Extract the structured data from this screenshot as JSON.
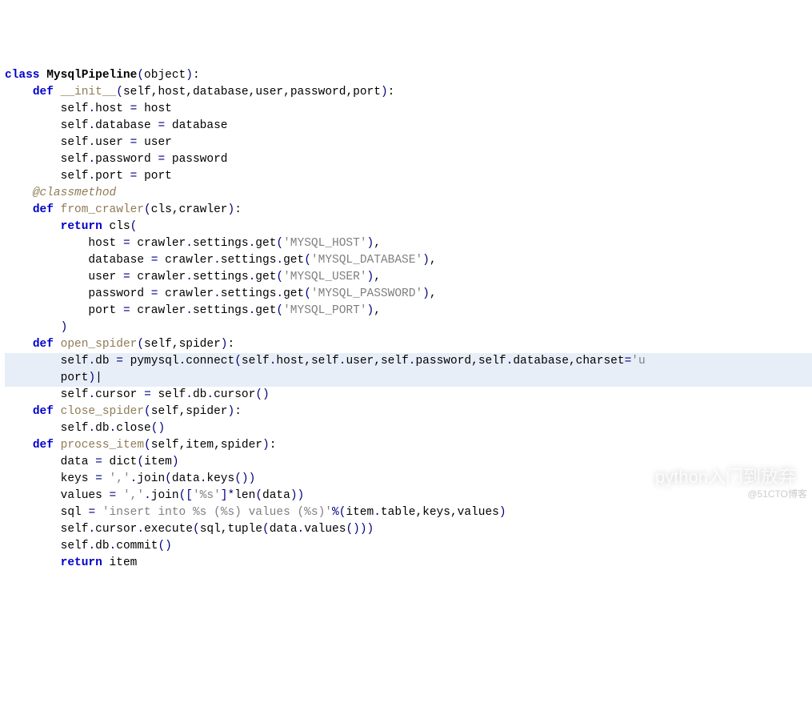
{
  "tokens": [
    [
      [
        "kw",
        "class"
      ],
      [
        "",
        ""
      ],
      [
        "cls",
        "MysqlPipeline"
      ],
      [
        "paren",
        "("
      ],
      [
        "id",
        "object"
      ],
      [
        "paren",
        ")"
      ],
      [
        "punct",
        ":"
      ]
    ],
    [
      [
        "",
        "    "
      ],
      [
        "kw",
        "def"
      ],
      [
        "",
        ""
      ],
      [
        "fn",
        "__init__"
      ],
      [
        "paren",
        "("
      ],
      [
        "id",
        "self"
      ],
      [
        "punct",
        ","
      ],
      [
        "id",
        "host"
      ],
      [
        "punct",
        ","
      ],
      [
        "id",
        "database"
      ],
      [
        "punct",
        ","
      ],
      [
        "id",
        "user"
      ],
      [
        "punct",
        ","
      ],
      [
        "id",
        "password"
      ],
      [
        "punct",
        ","
      ],
      [
        "id",
        "port"
      ],
      [
        "paren",
        ")"
      ],
      [
        "punct",
        ":"
      ]
    ],
    [
      [
        "",
        "        "
      ],
      [
        "id",
        "self"
      ],
      [
        "op",
        "."
      ],
      [
        "id",
        "host"
      ],
      [
        "",
        ""
      ],
      [
        "op",
        "="
      ],
      [
        "",
        ""
      ],
      [
        "id",
        "host"
      ]
    ],
    [
      [
        "",
        "        "
      ],
      [
        "id",
        "self"
      ],
      [
        "op",
        "."
      ],
      [
        "id",
        "database"
      ],
      [
        "",
        ""
      ],
      [
        "op",
        "="
      ],
      [
        "",
        ""
      ],
      [
        "id",
        "database"
      ]
    ],
    [
      [
        "",
        "        "
      ],
      [
        "id",
        "self"
      ],
      [
        "op",
        "."
      ],
      [
        "id",
        "user"
      ],
      [
        "",
        ""
      ],
      [
        "op",
        "="
      ],
      [
        "",
        ""
      ],
      [
        "id",
        "user"
      ]
    ],
    [
      [
        "",
        "        "
      ],
      [
        "id",
        "self"
      ],
      [
        "op",
        "."
      ],
      [
        "id",
        "password"
      ],
      [
        "",
        ""
      ],
      [
        "op",
        "="
      ],
      [
        "",
        ""
      ],
      [
        "id",
        "password"
      ]
    ],
    [
      [
        "",
        "        "
      ],
      [
        "id",
        "self"
      ],
      [
        "op",
        "."
      ],
      [
        "id",
        "port"
      ],
      [
        "",
        ""
      ],
      [
        "op",
        "="
      ],
      [
        "",
        ""
      ],
      [
        "id",
        "port"
      ]
    ],
    [
      [
        "",
        "    "
      ],
      [
        "dec",
        "@classmethod"
      ]
    ],
    [
      [
        "",
        "    "
      ],
      [
        "kw",
        "def"
      ],
      [
        "",
        ""
      ],
      [
        "fn",
        "from_crawler"
      ],
      [
        "paren",
        "("
      ],
      [
        "id",
        "cls"
      ],
      [
        "punct",
        ","
      ],
      [
        "id",
        "crawler"
      ],
      [
        "paren",
        ")"
      ],
      [
        "punct",
        ":"
      ]
    ],
    [
      [
        "",
        "        "
      ],
      [
        "kw",
        "return"
      ],
      [
        "",
        ""
      ],
      [
        "id",
        "cls"
      ],
      [
        "paren",
        "("
      ]
    ],
    [
      [
        "",
        "            "
      ],
      [
        "id",
        "host"
      ],
      [
        "",
        ""
      ],
      [
        "op",
        "="
      ],
      [
        "",
        ""
      ],
      [
        "id",
        "crawler"
      ],
      [
        "op",
        "."
      ],
      [
        "id",
        "settings"
      ],
      [
        "op",
        "."
      ],
      [
        "id",
        "get"
      ],
      [
        "paren",
        "("
      ],
      [
        "str",
        "'MYSQL_HOST'"
      ],
      [
        "paren",
        ")"
      ],
      [
        "punct",
        ","
      ]
    ],
    [
      [
        "",
        "            "
      ],
      [
        "id",
        "database"
      ],
      [
        "",
        ""
      ],
      [
        "op",
        "="
      ],
      [
        "",
        ""
      ],
      [
        "id",
        "crawler"
      ],
      [
        "op",
        "."
      ],
      [
        "id",
        "settings"
      ],
      [
        "op",
        "."
      ],
      [
        "id",
        "get"
      ],
      [
        "paren",
        "("
      ],
      [
        "str",
        "'MYSQL_DATABASE'"
      ],
      [
        "paren",
        ")"
      ],
      [
        "punct",
        ","
      ]
    ],
    [
      [
        "",
        "            "
      ],
      [
        "id",
        "user"
      ],
      [
        "",
        ""
      ],
      [
        "op",
        "="
      ],
      [
        "",
        ""
      ],
      [
        "id",
        "crawler"
      ],
      [
        "op",
        "."
      ],
      [
        "id",
        "settings"
      ],
      [
        "op",
        "."
      ],
      [
        "id",
        "get"
      ],
      [
        "paren",
        "("
      ],
      [
        "str",
        "'MYSQL_USER'"
      ],
      [
        "paren",
        ")"
      ],
      [
        "punct",
        ","
      ]
    ],
    [
      [
        "",
        "            "
      ],
      [
        "id",
        "password"
      ],
      [
        "",
        ""
      ],
      [
        "op",
        "="
      ],
      [
        "",
        ""
      ],
      [
        "id",
        "crawler"
      ],
      [
        "op",
        "."
      ],
      [
        "id",
        "settings"
      ],
      [
        "op",
        "."
      ],
      [
        "id",
        "get"
      ],
      [
        "paren",
        "("
      ],
      [
        "str",
        "'MYSQL_PASSWORD'"
      ],
      [
        "paren",
        ")"
      ],
      [
        "punct",
        ","
      ]
    ],
    [
      [
        "",
        "            "
      ],
      [
        "id",
        "port"
      ],
      [
        "",
        ""
      ],
      [
        "op",
        "="
      ],
      [
        "",
        ""
      ],
      [
        "id",
        "crawler"
      ],
      [
        "op",
        "."
      ],
      [
        "id",
        "settings"
      ],
      [
        "op",
        "."
      ],
      [
        "id",
        "get"
      ],
      [
        "paren",
        "("
      ],
      [
        "str",
        "'MYSQL_PORT'"
      ],
      [
        "paren",
        ")"
      ],
      [
        "punct",
        ","
      ]
    ],
    [
      [
        "",
        "        "
      ],
      [
        "paren",
        ")"
      ]
    ],
    [
      [
        "",
        "    "
      ],
      [
        "kw",
        "def"
      ],
      [
        "",
        ""
      ],
      [
        "fn",
        "open_spider"
      ],
      [
        "paren",
        "("
      ],
      [
        "id",
        "self"
      ],
      [
        "punct",
        ","
      ],
      [
        "id",
        "spider"
      ],
      [
        "paren",
        ")"
      ],
      [
        "punct",
        ":"
      ]
    ],
    [
      [
        "",
        "        "
      ],
      [
        "id",
        "self"
      ],
      [
        "op",
        "."
      ],
      [
        "id",
        "db"
      ],
      [
        "",
        ""
      ],
      [
        "op",
        "="
      ],
      [
        "",
        ""
      ],
      [
        "id",
        "pymysql"
      ],
      [
        "op",
        "."
      ],
      [
        "id",
        "connect"
      ],
      [
        "paren",
        "("
      ],
      [
        "id",
        "self"
      ],
      [
        "op",
        "."
      ],
      [
        "id",
        "host"
      ],
      [
        "punct",
        ","
      ],
      [
        "id",
        "self"
      ],
      [
        "op",
        "."
      ],
      [
        "id",
        "user"
      ],
      [
        "punct",
        ","
      ],
      [
        "id",
        "self"
      ],
      [
        "op",
        "."
      ],
      [
        "id",
        "password"
      ],
      [
        "punct",
        ","
      ],
      [
        "id",
        "self"
      ],
      [
        "op",
        "."
      ],
      [
        "id",
        "database"
      ],
      [
        "punct",
        ","
      ],
      [
        "id",
        "charset"
      ],
      [
        "op",
        "="
      ],
      [
        "str",
        "'u"
      ]
    ],
    [
      [
        "",
        "        "
      ],
      [
        "id",
        "port"
      ],
      [
        "paren",
        ")"
      ],
      [
        "id",
        "|"
      ]
    ],
    [
      [
        "",
        "        "
      ],
      [
        "id",
        "self"
      ],
      [
        "op",
        "."
      ],
      [
        "id",
        "cursor"
      ],
      [
        "",
        ""
      ],
      [
        "op",
        "="
      ],
      [
        "",
        ""
      ],
      [
        "id",
        "self"
      ],
      [
        "op",
        "."
      ],
      [
        "id",
        "db"
      ],
      [
        "op",
        "."
      ],
      [
        "id",
        "cursor"
      ],
      [
        "paren",
        "()"
      ]
    ],
    [
      [
        "",
        "    "
      ],
      [
        "kw",
        "def"
      ],
      [
        "",
        ""
      ],
      [
        "fn",
        "close_spider"
      ],
      [
        "paren",
        "("
      ],
      [
        "id",
        "self"
      ],
      [
        "punct",
        ","
      ],
      [
        "id",
        "spider"
      ],
      [
        "paren",
        ")"
      ],
      [
        "punct",
        ":"
      ]
    ],
    [
      [
        "",
        "        "
      ],
      [
        "id",
        "self"
      ],
      [
        "op",
        "."
      ],
      [
        "id",
        "db"
      ],
      [
        "op",
        "."
      ],
      [
        "id",
        "close"
      ],
      [
        "paren",
        "()"
      ]
    ],
    [
      [
        "",
        "    "
      ],
      [
        "kw",
        "def"
      ],
      [
        "",
        ""
      ],
      [
        "fn",
        "process_item"
      ],
      [
        "paren",
        "("
      ],
      [
        "id",
        "self"
      ],
      [
        "punct",
        ","
      ],
      [
        "id",
        "item"
      ],
      [
        "punct",
        ","
      ],
      [
        "id",
        "spider"
      ],
      [
        "paren",
        ")"
      ],
      [
        "punct",
        ":"
      ]
    ],
    [
      [
        "",
        "        "
      ],
      [
        "id",
        "data"
      ],
      [
        "",
        ""
      ],
      [
        "op",
        "="
      ],
      [
        "",
        ""
      ],
      [
        "id",
        "dict"
      ],
      [
        "paren",
        "("
      ],
      [
        "id",
        "item"
      ],
      [
        "paren",
        ")"
      ]
    ],
    [
      [
        "",
        "        "
      ],
      [
        "id",
        "keys"
      ],
      [
        "",
        ""
      ],
      [
        "op",
        "="
      ],
      [
        "",
        ""
      ],
      [
        "str",
        "','"
      ],
      [
        "op",
        "."
      ],
      [
        "id",
        "join"
      ],
      [
        "paren",
        "("
      ],
      [
        "id",
        "data"
      ],
      [
        "op",
        "."
      ],
      [
        "id",
        "keys"
      ],
      [
        "paren",
        "())"
      ]
    ],
    [
      [
        "",
        "        "
      ],
      [
        "id",
        "values"
      ],
      [
        "",
        ""
      ],
      [
        "op",
        "="
      ],
      [
        "",
        ""
      ],
      [
        "str",
        "','"
      ],
      [
        "op",
        "."
      ],
      [
        "id",
        "join"
      ],
      [
        "paren",
        "(["
      ],
      [
        "str",
        "'%s'"
      ],
      [
        "paren",
        "]"
      ],
      [
        "op",
        "*"
      ],
      [
        "id",
        "len"
      ],
      [
        "paren",
        "("
      ],
      [
        "id",
        "data"
      ],
      [
        "paren",
        "))"
      ]
    ],
    [
      [
        "",
        "        "
      ],
      [
        "id",
        "sql"
      ],
      [
        "",
        ""
      ],
      [
        "op",
        "="
      ],
      [
        "",
        ""
      ],
      [
        "str",
        "'insert into %s (%s) values (%s)'"
      ],
      [
        "op",
        "%"
      ],
      [
        "paren",
        "("
      ],
      [
        "id",
        "item"
      ],
      [
        "op",
        "."
      ],
      [
        "id",
        "table"
      ],
      [
        "punct",
        ","
      ],
      [
        "id",
        "keys"
      ],
      [
        "punct",
        ","
      ],
      [
        "id",
        "values"
      ],
      [
        "paren",
        ")"
      ]
    ],
    [
      [
        "",
        "        "
      ],
      [
        "id",
        "self"
      ],
      [
        "op",
        "."
      ],
      [
        "id",
        "cursor"
      ],
      [
        "op",
        "."
      ],
      [
        "id",
        "execute"
      ],
      [
        "paren",
        "("
      ],
      [
        "id",
        "sql"
      ],
      [
        "punct",
        ","
      ],
      [
        "id",
        "tuple"
      ],
      [
        "paren",
        "("
      ],
      [
        "id",
        "data"
      ],
      [
        "op",
        "."
      ],
      [
        "id",
        "values"
      ],
      [
        "paren",
        "()))"
      ]
    ],
    [
      [
        "",
        "        "
      ],
      [
        "id",
        "self"
      ],
      [
        "op",
        "."
      ],
      [
        "id",
        "db"
      ],
      [
        "op",
        "."
      ],
      [
        "id",
        "commit"
      ],
      [
        "paren",
        "()"
      ]
    ],
    [
      [
        "",
        "        "
      ],
      [
        "kw",
        "return"
      ],
      [
        "",
        ""
      ],
      [
        "id",
        "item"
      ]
    ]
  ],
  "highlight_lines": [
    17,
    18
  ],
  "watermark": "python入门到放弃",
  "blogmark": "@51CTO博客"
}
